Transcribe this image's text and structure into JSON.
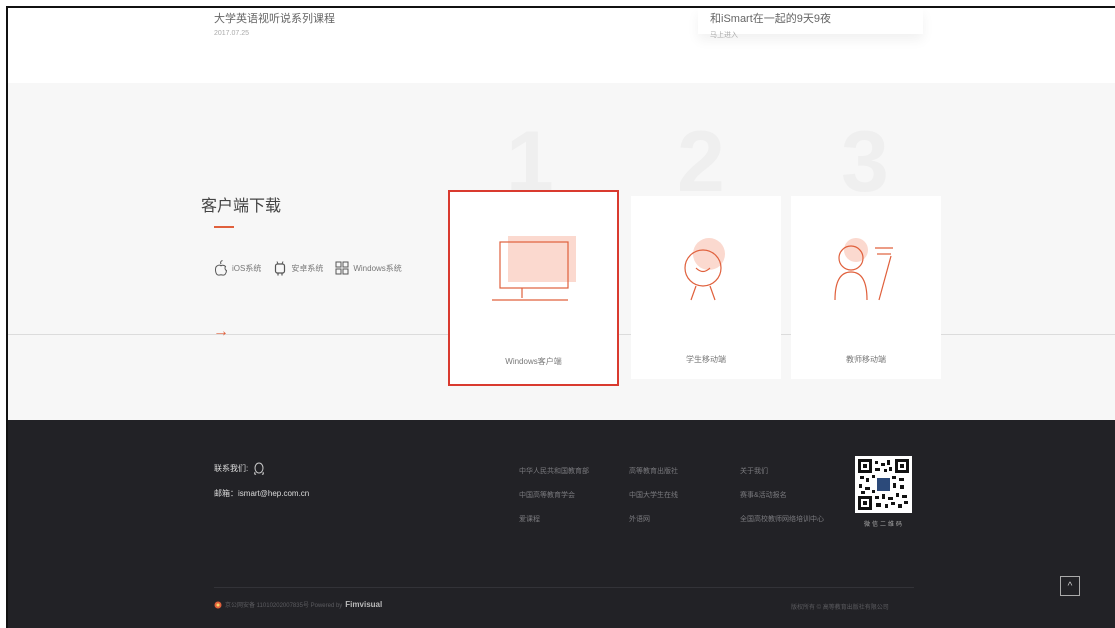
{
  "news": [
    {
      "title": "大学英语视听说系列课程",
      "sub": "2017.07.25"
    },
    {
      "title": "和iSmart在一起的9天9夜",
      "sub": "马上进入"
    }
  ],
  "download": {
    "title": "客户端下载",
    "arrow": "→",
    "os": [
      {
        "icon": "apple-icon",
        "label": "iOS系统"
      },
      {
        "icon": "android-icon",
        "label": "安卓系统"
      },
      {
        "icon": "windows-icon",
        "label": "Windows系统"
      }
    ],
    "numbers": [
      "1",
      "2",
      "3"
    ],
    "cards": [
      {
        "label": "Windows客户端",
        "icon": "monitor-icon",
        "selected": true
      },
      {
        "label": "学生移动端",
        "icon": "student-icon",
        "selected": false
      },
      {
        "label": "教师移动端",
        "icon": "teacher-icon",
        "selected": false
      }
    ]
  },
  "footer": {
    "contact_label": "联系我们:",
    "email": "邮箱：ismart@hep.com.cn",
    "links": {
      "col1": [
        "中华人民共和国教育部",
        "中国高等教育学会",
        "爱课程"
      ],
      "col2": [
        "高等教育出版社",
        "中国大学生在线",
        "外语网"
      ],
      "col3": [
        "关于我们",
        "赛事&活动报名",
        "全国高校教师网络培训中心"
      ]
    },
    "qr_caption": "微信二维码",
    "icp": "京公网安备 11010202007835号 Powered by",
    "brand": "Fimvisual",
    "copyright": "版权所有 © 高等教育出版社有限公司",
    "to_top": "^"
  },
  "colors": {
    "accent": "#e0603c",
    "selection": "#d93a2f",
    "footer_bg": "#222226"
  }
}
